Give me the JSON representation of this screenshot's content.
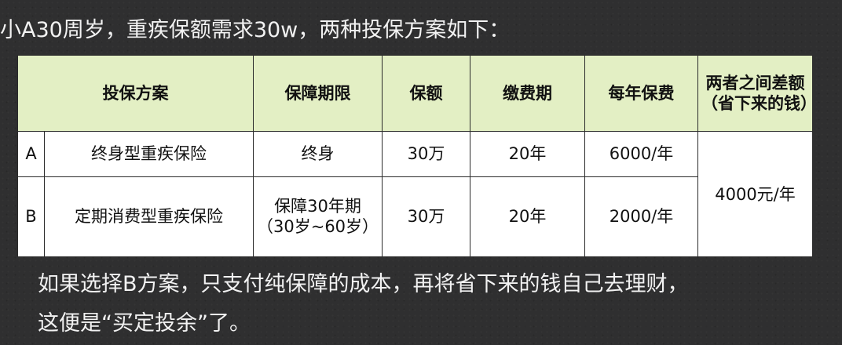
{
  "intro": "小A30周岁，重疾保额需求30w，两种投保方案如下：",
  "table": {
    "headers": {
      "plan": "投保方案",
      "period": "保障期限",
      "amount": "保额",
      "payment_term": "缴费期",
      "annual_premium": "每年保费",
      "difference": "两者之间差额（省下来的钱）"
    },
    "rows": [
      {
        "letter": "A",
        "plan": "终身型重疾保险",
        "period": "终身",
        "amount": "30万",
        "payment_term": "20年",
        "annual_premium": "6000/年"
      },
      {
        "letter": "B",
        "plan": "定期消费型重疾保险",
        "period": "保障30年期（30岁~60岁）",
        "amount": "30万",
        "payment_term": "20年",
        "annual_premium": "2000/年"
      }
    ],
    "difference_value": "4000元/年"
  },
  "outro": [
    "如果选择B方案，只支付纯保障的成本，再将省下来的钱自己去理财，",
    "这便是“买定投余”了。"
  ]
}
